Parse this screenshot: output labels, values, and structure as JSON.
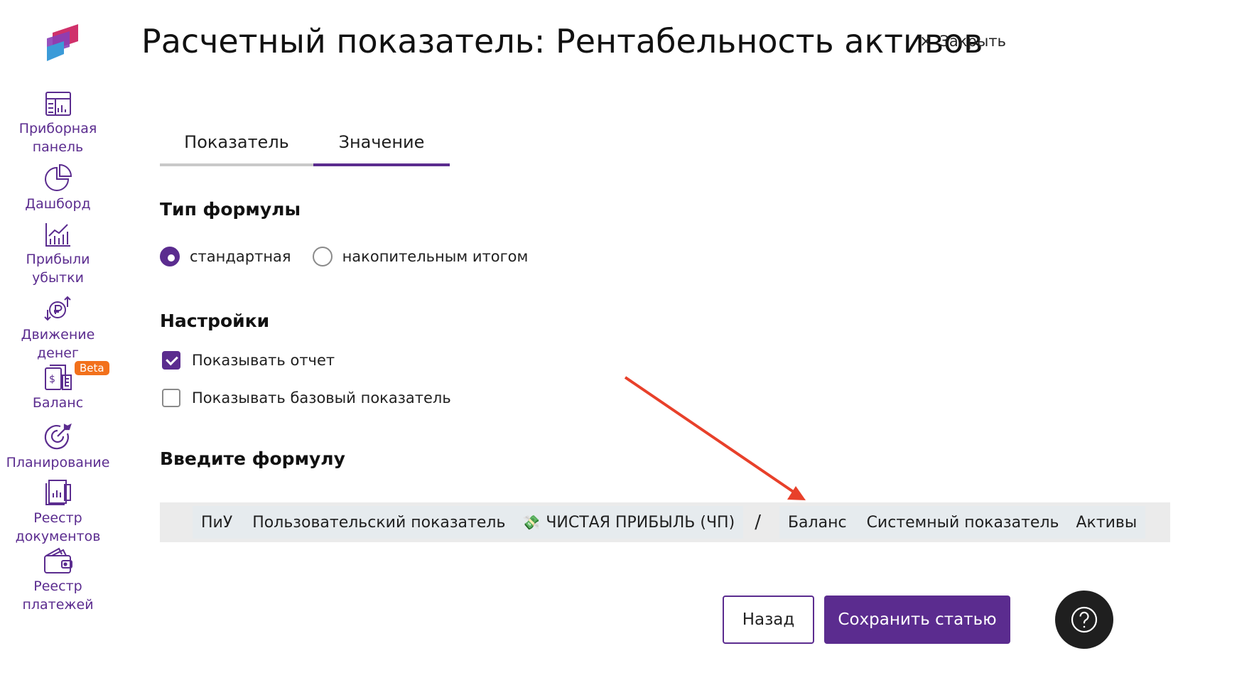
{
  "header": {
    "title": "Расчетный показатель: Рентабельность активов",
    "close_icon": "×",
    "close_label": "Закрыть"
  },
  "sidebar": {
    "items": [
      {
        "label": "Приборная\nпанель",
        "icon": "dashboard-panel-icon"
      },
      {
        "label": "Дашборд",
        "icon": "pie-chart-icon"
      },
      {
        "label": "Прибыли\nубытки",
        "icon": "bar-chart-icon"
      },
      {
        "label": "Движение\nденег",
        "icon": "money-flow-icon"
      },
      {
        "label": "Баланс",
        "icon": "balance-icon",
        "badge": "Beta"
      },
      {
        "label": "Планирование",
        "icon": "target-icon"
      },
      {
        "label": "Реестр\nдокументов",
        "icon": "documents-icon"
      },
      {
        "label": "Реестр\nплатежей",
        "icon": "wallet-icon"
      }
    ]
  },
  "tabs": [
    {
      "label": "Показатель",
      "active": false
    },
    {
      "label": "Значение",
      "active": true
    }
  ],
  "formula_type": {
    "heading": "Тип формулы",
    "options": [
      {
        "label": "стандартная",
        "selected": true
      },
      {
        "label": "накопительным итогом",
        "selected": false
      }
    ]
  },
  "settings": {
    "heading": "Настройки",
    "options": [
      {
        "label": "Показывать отчет",
        "checked": true
      },
      {
        "label": "Показывать базовый показатель",
        "checked": false
      }
    ]
  },
  "formula": {
    "heading": "Введите формулу",
    "token1": {
      "category": "ПиУ",
      "type": "Пользовательский показатель",
      "icon": "💸",
      "name": "ЧИСТАЯ ПРИБЫЛЬ (ЧП)"
    },
    "operator": "/",
    "token2": {
      "category": "Баланс",
      "type": "Системный показатель",
      "name": "Активы"
    }
  },
  "buttons": {
    "back": "Назад",
    "save": "Сохранить статью"
  },
  "colors": {
    "accent": "#5b2c8f",
    "annotation_arrow": "#e8402a",
    "help_bg": "#1f1f1f"
  }
}
